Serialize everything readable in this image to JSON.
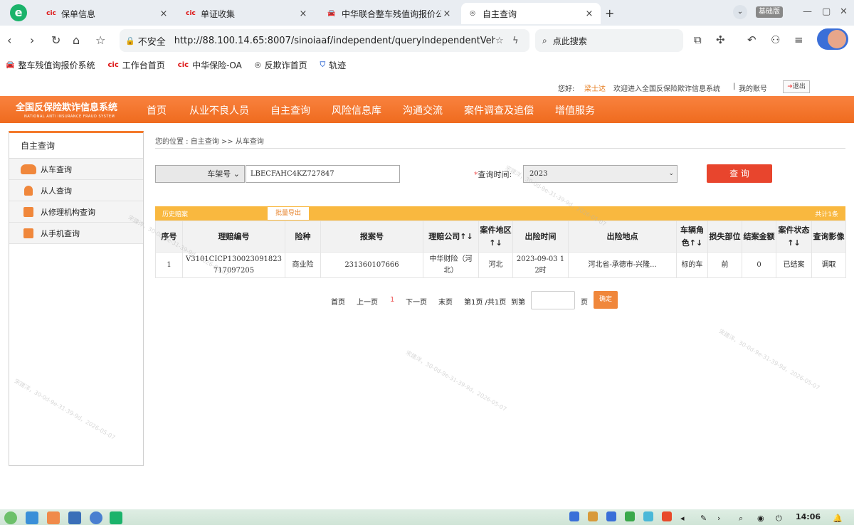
{
  "browser": {
    "tabs": [
      {
        "title": "保单信息",
        "icon": "cic-logo-icon"
      },
      {
        "title": "单证收集",
        "icon": "cic-logo-icon"
      },
      {
        "title": "中华联合整车残值询报价公",
        "icon": "car-icon"
      },
      {
        "title": "自主查询",
        "icon": "globe-icon"
      }
    ],
    "insecure_label": "不安全",
    "url": "http://88.100.14.65:8007/sinoiaaf/independent/queryIndependentVehicle.action",
    "search_placeholder": "点此搜索",
    "edition": "基础版",
    "bookmarks": [
      {
        "label": "整车残值询报价系统",
        "icon": "car-icon"
      },
      {
        "label": "工作台首页",
        "icon": "cic-logo-icon"
      },
      {
        "label": "中华保险-OA",
        "icon": "cic-logo-icon"
      },
      {
        "label": "反欺诈首页",
        "icon": "globe-icon"
      },
      {
        "label": "轨迹",
        "icon": "shield-icon"
      }
    ]
  },
  "header": {
    "greeting": "您好:",
    "username": "梁士达",
    "welcome": "欢迎进入全国反保险欺诈信息系统",
    "separator": "|",
    "my_account": "我的账号",
    "logout": "退出"
  },
  "system": {
    "name": "全国反保险欺诈信息系统",
    "name_en": "NATIONAL ANTI INSURANCE FRAUD SYSTEM"
  },
  "nav": [
    "首页",
    "从业不良人员",
    "自主查询",
    "风险信息库",
    "沟通交流",
    "案件调查及追偿",
    "增值服务"
  ],
  "sidebar": {
    "title": "自主查询",
    "items": [
      {
        "label": "从车查询",
        "icon": "car-icon"
      },
      {
        "label": "从人查询",
        "icon": "person-icon"
      },
      {
        "label": "从修理机构查询",
        "icon": "document-icon"
      },
      {
        "label": "从手机查询",
        "icon": "document-icon"
      }
    ]
  },
  "breadcrumb": "您的位置 : 自主查询 >> 从车查询",
  "search": {
    "field_select": "车架号",
    "vin_value": "LBECFAHC4KZ727847",
    "required_mark": "*",
    "time_label": "查询时间:",
    "year_value": "2023",
    "query_button": "查 询"
  },
  "results": {
    "history_label": "历史赔案",
    "batch_export": "批量导出",
    "total": "共计1条",
    "columns": [
      "序号",
      "理赔编号",
      "险种",
      "报案号",
      "理赔公司↑↓",
      "案件地区↑↓",
      "出险时间",
      "出险地点",
      "车辆角色↑↓",
      "损失部位",
      "结案金额",
      "案件状态↑↓",
      "查询影像"
    ],
    "rows": [
      [
        "1",
        "V3101CICP130023091823717097205",
        "商业险",
        "231360107666",
        "中华财险（河北）",
        "河北",
        "2023-09-03 12时",
        "河北省-承德市-兴隆...",
        "标的车",
        "前",
        "0",
        "已结案",
        "调取"
      ]
    ]
  },
  "pager": {
    "first": "首页",
    "prev": "上一页",
    "current": "1",
    "next": "下一页",
    "last": "末页",
    "info": "第1页 /共1页",
    "goto": "到第",
    "page_unit": "页",
    "confirm": "确定"
  },
  "watermark": "宋建洋，30-0d-9e-31-39-9d，2026-05-07",
  "taskbar": {
    "time": "14:06"
  },
  "colors": {
    "accent": "#f47a2c",
    "strip": "#f9b83f",
    "query_button": "#e8452d"
  }
}
